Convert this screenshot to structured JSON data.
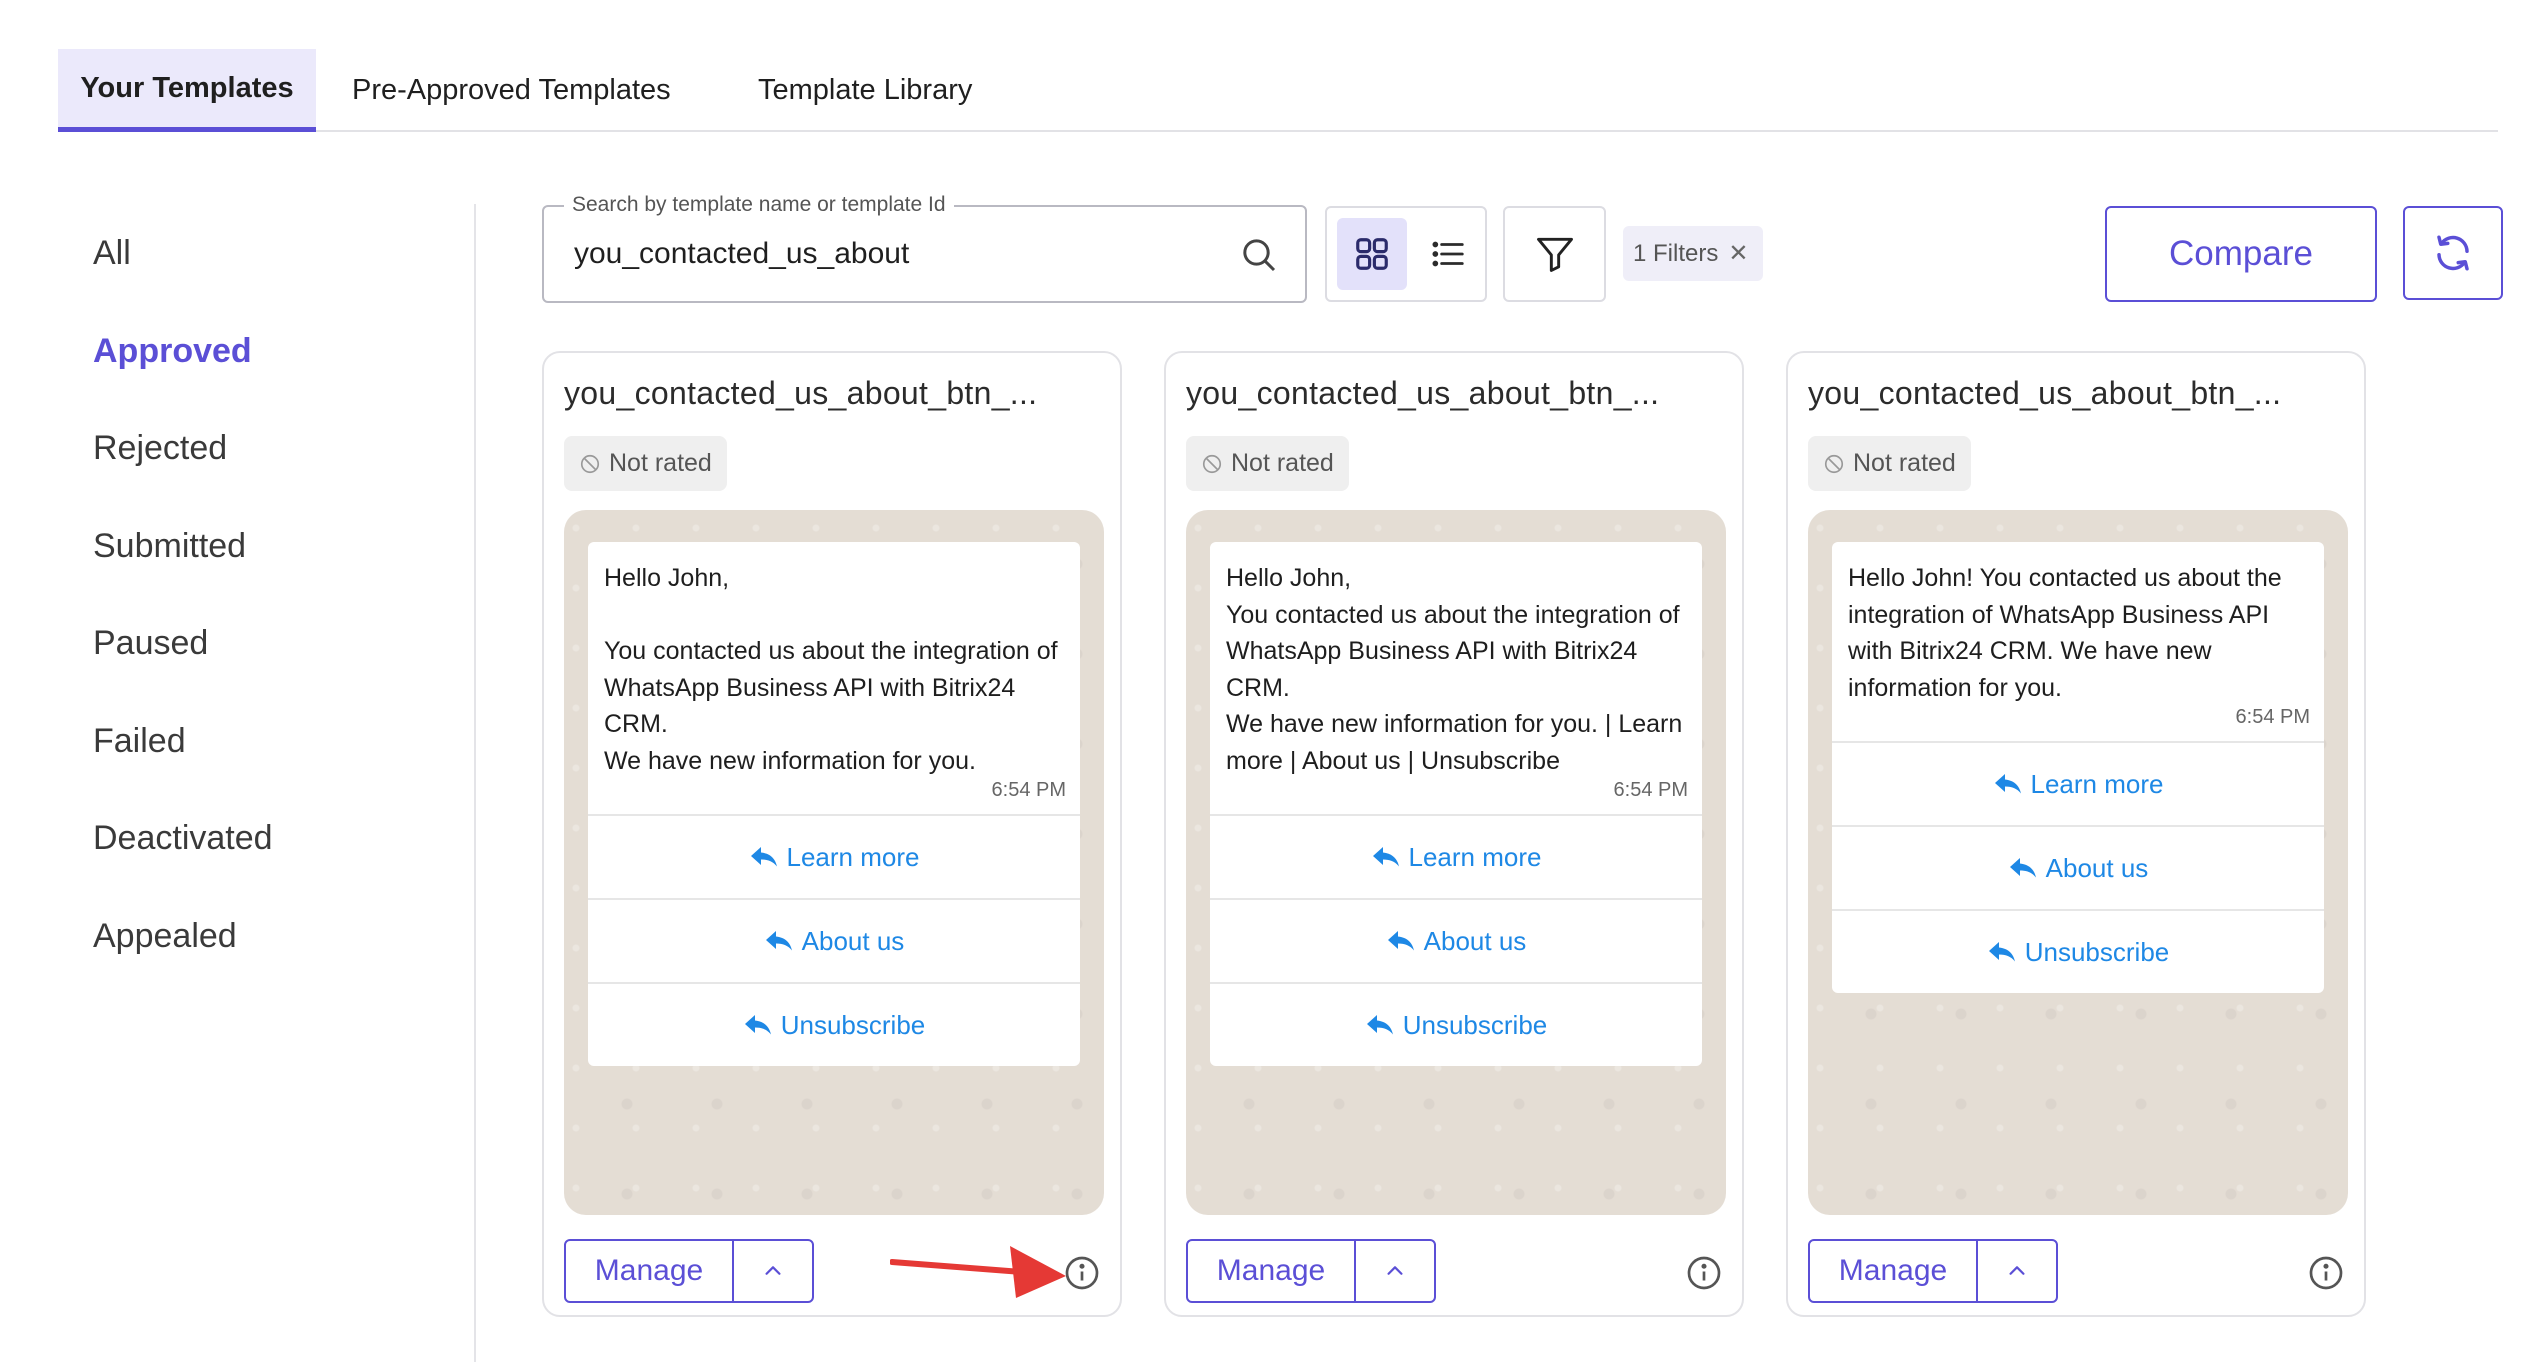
{
  "tabs": [
    {
      "label": "Your Templates",
      "active": true
    },
    {
      "label": "Pre-Approved Templates"
    },
    {
      "label": "Template Library"
    }
  ],
  "sidebar": {
    "items": [
      {
        "label": "All"
      },
      {
        "label": "Approved",
        "active": true
      },
      {
        "label": "Rejected"
      },
      {
        "label": "Submitted"
      },
      {
        "label": "Paused"
      },
      {
        "label": "Failed"
      },
      {
        "label": "Deactivated"
      },
      {
        "label": "Appealed"
      }
    ]
  },
  "search": {
    "label": "Search by template name or template Id",
    "value": "you_contacted_us_about"
  },
  "filters": {
    "chip_label": "1 Filters"
  },
  "toolbar": {
    "compare_label": "Compare"
  },
  "colors": {
    "accent": "#5b4fd6",
    "link": "#1e88e5",
    "annotation_arrow": "#e53935"
  },
  "cards": [
    {
      "title": "you_contacted_us_about_btn_...",
      "rating": "Not rated",
      "message": "Hello John,\n\nYou contacted us about the integration of WhatsApp Business API with Bitrix24 CRM.\nWe have new information for you.",
      "time": "6:54 PM",
      "buttons": [
        "Learn more",
        "About us",
        "Unsubscribe"
      ],
      "manage_label": "Manage"
    },
    {
      "title": "you_contacted_us_about_btn_...",
      "rating": "Not rated",
      "message": "Hello John,\nYou contacted us about the integration of WhatsApp Business API with Bitrix24 CRM.\nWe have new information for you. | Learn more | About us | Unsubscribe",
      "time": "6:54 PM",
      "buttons": [
        "Learn more",
        "About us",
        "Unsubscribe"
      ],
      "manage_label": "Manage"
    },
    {
      "title": "you_contacted_us_about_btn_...",
      "rating": "Not rated",
      "message": "Hello John! You contacted us about the integration of WhatsApp Business API with Bitrix24 CRM. We have new information for you.",
      "time": "6:54 PM",
      "buttons": [
        "Learn more",
        "About us",
        "Unsubscribe"
      ],
      "manage_label": "Manage"
    }
  ]
}
